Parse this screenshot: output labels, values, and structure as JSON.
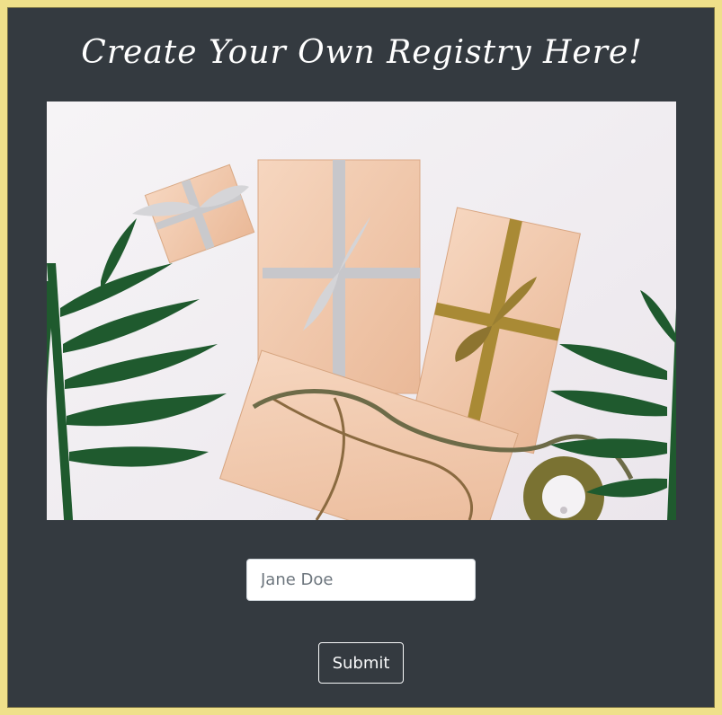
{
  "page": {
    "title": "Create Your Own Registry Here!"
  },
  "hero": {
    "image_name": "gift-boxes-photo"
  },
  "form": {
    "name_placeholder": "Jane Doe",
    "name_value": "",
    "submit_label": "Submit"
  },
  "colors": {
    "frame": "#efe08a",
    "panel": "#343a40",
    "button_border": "#f8f9fa"
  }
}
